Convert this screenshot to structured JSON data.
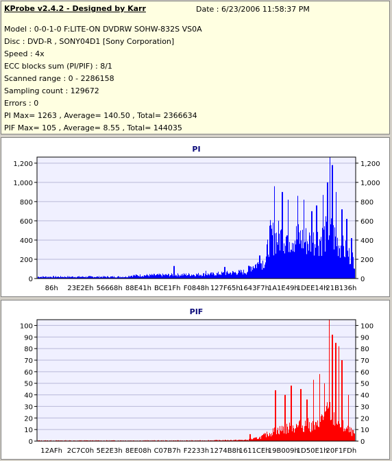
{
  "header": {
    "title": "KProbe v2.4.2 - Designed by Karr",
    "date": "Date : 6/23/2006 11:58:37 PM",
    "lines": [
      "Model : 0-0-1-0 F:LITE-ON DVDRW SOHW-832S  VS0A",
      "Disc : DVD-R , SONY04D1 [Sony Corporation]",
      "Speed : 4x",
      "ECC blocks sum (PI/PIF) : 8/1",
      "Scanned range : 0 - 2286158",
      "Sampling count : 129672",
      "Errors : 0",
      "PI Max= 1263 , Average= 140.50 , Total= 2366634",
      "PIF Max= 105 , Average= 8.55 , Total= 144035"
    ]
  },
  "chart_data": [
    {
      "type": "bar",
      "title": "PI",
      "xlabel": "",
      "ylabel": "",
      "color": "#0000ff",
      "ylim": [
        0,
        1263
      ],
      "yticks": [
        0,
        200,
        400,
        600,
        800,
        1000,
        1200
      ],
      "ytick_labels": [
        "0",
        "200",
        "400",
        "600",
        "800",
        "1,000",
        "1,200"
      ],
      "xtick_labels": [
        "86h",
        "23E2Eh",
        "56668h",
        "88E41h",
        "BCE1Fh",
        "F0848h",
        "127F65h",
        "1643F7h",
        "1A1E49h",
        "1DEE14h",
        "21B136h"
      ],
      "profile": [
        [
          0,
          18
        ],
        [
          0.28,
          18
        ],
        [
          0.29,
          30
        ],
        [
          0.55,
          45
        ],
        [
          0.66,
          70
        ],
        [
          0.67,
          120
        ],
        [
          0.72,
          180
        ],
        [
          0.73,
          420
        ],
        [
          0.8,
          440
        ],
        [
          0.86,
          380
        ],
        [
          0.9,
          420
        ],
        [
          0.92,
          500
        ],
        [
          0.95,
          360
        ],
        [
          1,
          180
        ]
      ],
      "spikes": [
        [
          0.43,
          130
        ],
        [
          0.53,
          80
        ],
        [
          0.59,
          120
        ],
        [
          0.7,
          240
        ],
        [
          0.747,
          960
        ],
        [
          0.772,
          900
        ],
        [
          0.79,
          820
        ],
        [
          0.82,
          860
        ],
        [
          0.84,
          820
        ],
        [
          0.865,
          700
        ],
        [
          0.88,
          760
        ],
        [
          0.9,
          870
        ],
        [
          0.915,
          1000
        ],
        [
          0.922,
          1263
        ],
        [
          0.93,
          1180
        ],
        [
          0.942,
          900
        ],
        [
          0.96,
          720
        ],
        [
          0.975,
          620
        ],
        [
          0.99,
          420
        ]
      ],
      "grid": true
    },
    {
      "type": "bar",
      "title": "PIF",
      "xlabel": "",
      "ylabel": "",
      "color": "#ff0000",
      "ylim": [
        0,
        105
      ],
      "yticks": [
        0,
        10,
        20,
        30,
        40,
        50,
        60,
        70,
        80,
        90,
        100
      ],
      "ytick_labels": [
        "0",
        "10",
        "20",
        "30",
        "40",
        "50",
        "60",
        "70",
        "80",
        "90",
        "100"
      ],
      "xtick_labels": [
        "12AFh",
        "2C7C0h",
        "5E2E3h",
        "8EE08h",
        "C07B7h",
        "F2233h",
        "1274B8h",
        "1611CEh",
        "19B009h",
        "1D50E1h",
        "20F1FDh"
      ],
      "profile": [
        [
          0,
          0.5
        ],
        [
          0.5,
          0.5
        ],
        [
          0.66,
          1
        ],
        [
          0.7,
          3
        ],
        [
          0.75,
          9
        ],
        [
          0.85,
          14
        ],
        [
          0.88,
          12
        ],
        [
          0.9,
          20
        ],
        [
          0.92,
          26
        ],
        [
          0.95,
          15
        ],
        [
          1,
          6
        ]
      ],
      "spikes": [
        [
          0.67,
          6
        ],
        [
          0.75,
          44
        ],
        [
          0.78,
          40
        ],
        [
          0.8,
          48
        ],
        [
          0.83,
          45
        ],
        [
          0.85,
          36
        ],
        [
          0.87,
          53
        ],
        [
          0.89,
          58
        ],
        [
          0.905,
          50
        ],
        [
          0.92,
          105
        ],
        [
          0.93,
          92
        ],
        [
          0.94,
          85
        ],
        [
          0.95,
          82
        ],
        [
          0.96,
          70
        ],
        [
          0.98,
          40
        ]
      ],
      "grid": true
    }
  ]
}
